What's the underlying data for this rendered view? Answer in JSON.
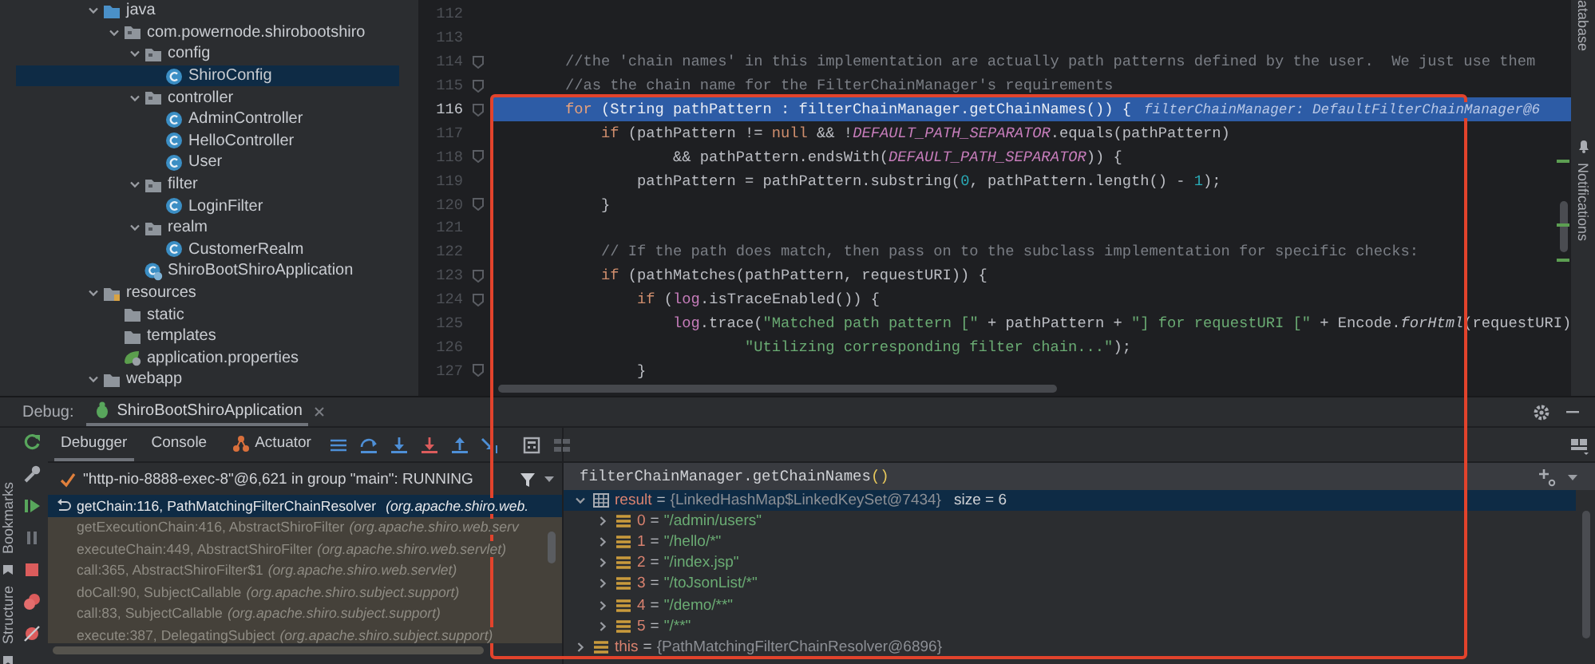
{
  "project_tree": [
    {
      "label": "java",
      "kind": "source-folder",
      "expanded": true,
      "selected": false,
      "children": [
        {
          "label": "com.powernode.shirobootshiro",
          "kind": "package",
          "expanded": true,
          "selected": false,
          "children": [
            {
              "label": "config",
              "kind": "package",
              "expanded": true,
              "selected": false,
              "children": [
                {
                  "label": "ShiroConfig",
                  "kind": "class",
                  "selected": true
                }
              ]
            },
            {
              "label": "controller",
              "kind": "package",
              "expanded": true,
              "selected": false,
              "children": [
                {
                  "label": "AdminController",
                  "kind": "class",
                  "selected": false
                },
                {
                  "label": "HelloController",
                  "kind": "class",
                  "selected": false
                },
                {
                  "label": "User",
                  "kind": "class",
                  "selected": false
                }
              ]
            },
            {
              "label": "filter",
              "kind": "package",
              "expanded": true,
              "selected": false,
              "children": [
                {
                  "label": "LoginFilter",
                  "kind": "class",
                  "selected": false
                }
              ]
            },
            {
              "label": "realm",
              "kind": "package",
              "expanded": true,
              "selected": false,
              "children": [
                {
                  "label": "CustomerRealm",
                  "kind": "class",
                  "selected": false
                }
              ]
            },
            {
              "label": "ShiroBootShiroApplication",
              "kind": "app-class",
              "selected": false
            }
          ]
        }
      ]
    },
    {
      "label": "resources",
      "kind": "resource-folder",
      "expanded": true,
      "selected": false,
      "children": [
        {
          "label": "static",
          "kind": "folder",
          "selected": false
        },
        {
          "label": "templates",
          "kind": "folder",
          "selected": false
        },
        {
          "label": "application.properties",
          "kind": "properties",
          "selected": false
        }
      ]
    },
    {
      "label": "webapp",
      "kind": "folder",
      "expanded": true,
      "selected": false
    }
  ],
  "editor": {
    "lines": [
      {
        "number": "112",
        "current": false,
        "fold": false
      },
      {
        "number": "113",
        "current": false,
        "fold": false
      },
      {
        "number": "114",
        "current": false,
        "fold": true,
        "tokens": [
          {
            "kind": "comment",
            "text": "        //the 'chain names' in this implementation are actually path patterns defined by the user.  We just use them"
          }
        ]
      },
      {
        "number": "115",
        "current": false,
        "fold": true,
        "tokens": [
          {
            "kind": "comment",
            "text": "        //as the chain name for the FilterChainManager's requirements"
          }
        ]
      },
      {
        "number": "116",
        "current": true,
        "fold": true,
        "tokens": [
          {
            "kind": "keyword",
            "text": "        for"
          },
          {
            "kind": "plain",
            "text": " (String pathPattern : filterChainManager.getChainNames()) {"
          }
        ],
        "hint": "filterChainManager: DefaultFilterChainManager@6"
      },
      {
        "number": "117",
        "current": false,
        "fold": false,
        "tokens": [
          {
            "kind": "keyword",
            "text": "            if"
          },
          {
            "kind": "plain",
            "text": " (pathPattern != "
          },
          {
            "kind": "keyword",
            "text": "null"
          },
          {
            "kind": "plain",
            "text": " && !"
          },
          {
            "kind": "constant",
            "text": "DEFAULT_PATH_SEPARATOR"
          },
          {
            "kind": "plain",
            "text": ".equals(pathPattern)"
          }
        ]
      },
      {
        "number": "118",
        "current": false,
        "fold": true,
        "tokens": [
          {
            "kind": "plain",
            "text": "                    && pathPattern.endsWith("
          },
          {
            "kind": "constant",
            "text": "DEFAULT_PATH_SEPARATOR"
          },
          {
            "kind": "plain",
            "text": ")) {"
          }
        ]
      },
      {
        "number": "119",
        "current": false,
        "fold": false,
        "tokens": [
          {
            "kind": "plain",
            "text": "                pathPattern = pathPattern.substring("
          },
          {
            "kind": "number",
            "text": "0"
          },
          {
            "kind": "plain",
            "text": ", pathPattern.length() - "
          },
          {
            "kind": "number",
            "text": "1"
          },
          {
            "kind": "plain",
            "text": ");"
          }
        ]
      },
      {
        "number": "120",
        "current": false,
        "fold": true,
        "tokens": [
          {
            "kind": "plain",
            "text": "            }"
          }
        ]
      },
      {
        "number": "121",
        "current": false,
        "fold": false
      },
      {
        "number": "122",
        "current": false,
        "fold": false,
        "tokens": [
          {
            "kind": "comment",
            "text": "            // If the path does match, then pass on to the subclass implementation for specific checks:"
          }
        ]
      },
      {
        "number": "123",
        "current": false,
        "fold": true,
        "tokens": [
          {
            "kind": "keyword",
            "text": "            if"
          },
          {
            "kind": "plain",
            "text": " (pathMatches(pathPattern, requestURI)) {"
          }
        ]
      },
      {
        "number": "124",
        "current": false,
        "fold": true,
        "tokens": [
          {
            "kind": "keyword",
            "text": "                if"
          },
          {
            "kind": "plain",
            "text": " ("
          },
          {
            "kind": "field",
            "text": "log"
          },
          {
            "kind": "plain",
            "text": ".isTraceEnabled()) {"
          }
        ]
      },
      {
        "number": "125",
        "current": false,
        "fold": false,
        "tokens": [
          {
            "kind": "field",
            "text": "                    log"
          },
          {
            "kind": "plain",
            "text": ".trace("
          },
          {
            "kind": "string",
            "text": "\"Matched path pattern [\""
          },
          {
            "kind": "plain",
            "text": " + pathPattern + "
          },
          {
            "kind": "string",
            "text": "\"] for requestURI [\""
          },
          {
            "kind": "plain",
            "text": " + Encode."
          },
          {
            "kind": "method",
            "text": "forHtml"
          },
          {
            "kind": "plain",
            "text": "(requestURI)"
          }
        ]
      },
      {
        "number": "126",
        "current": false,
        "fold": false,
        "tokens": [
          {
            "kind": "string",
            "text": "                            \"Utilizing corresponding filter chain...\""
          },
          {
            "kind": "plain",
            "text": ");"
          }
        ]
      },
      {
        "number": "127",
        "current": false,
        "fold": true,
        "tokens": [
          {
            "kind": "plain",
            "text": "                }"
          }
        ]
      }
    ]
  },
  "right_strip": [
    "atabase",
    "Notifications"
  ],
  "left_strip": [
    "Bookmarks",
    "Structure"
  ],
  "debug": {
    "title": "Debug:",
    "session": {
      "label": "ShiroBootShiroApplication",
      "closable": true
    },
    "tabs": [
      {
        "label": "Debugger",
        "kind": "text",
        "selected": true
      },
      {
        "label": "Console",
        "kind": "text",
        "selected": false
      },
      {
        "label": "Actuator",
        "kind": "plugin",
        "selected": false
      }
    ],
    "thread": "\"http-nio-8888-exec-8\"@6,621 in group \"main\": RUNNING",
    "frames": [
      {
        "method": "getChain:116, PathMatchingFilterChainResolver",
        "package": "(org.apache.shiro.web.",
        "selected": true
      },
      {
        "method": "getExecutionChain:416, AbstractShiroFilter",
        "package": "(org.apache.shiro.web.serv",
        "selected": false
      },
      {
        "method": "executeChain:449, AbstractShiroFilter",
        "package": "(org.apache.shiro.web.servlet)",
        "selected": false
      },
      {
        "method": "call:365, AbstractShiroFilter$1",
        "package": "(org.apache.shiro.web.servlet)",
        "selected": false
      },
      {
        "method": "doCall:90, SubjectCallable",
        "package": "(org.apache.shiro.subject.support)",
        "selected": false
      },
      {
        "method": "call:83, SubjectCallable",
        "package": "(org.apache.shiro.subject.support)",
        "selected": false
      },
      {
        "method": "execute:387, DelegatingSubject",
        "package": "(org.apache.shiro.subject.support)",
        "selected": false
      }
    ],
    "variables": {
      "call": "filterChainManager.getChainNames",
      "parens": "()",
      "items": [
        {
          "name": "result",
          "operator": "=",
          "value": "{LinkedHashMap$LinkedKeySet@7434}",
          "size": "size = 6",
          "kind": "collection",
          "expanded": true,
          "selected": true,
          "children": [
            {
              "name": "0",
              "operator": "=",
              "value": "\"/admin/users\"",
              "kind": "element",
              "expanded": false,
              "selected": false
            },
            {
              "name": "1",
              "operator": "=",
              "value": "\"/hello/*\"",
              "kind": "element",
              "expanded": false,
              "selected": false
            },
            {
              "name": "2",
              "operator": "=",
              "value": "\"/index.jsp\"",
              "kind": "element",
              "expanded": false,
              "selected": false
            },
            {
              "name": "3",
              "operator": "=",
              "value": "\"/toJsonList/*\"",
              "kind": "element",
              "expanded": false,
              "selected": false
            },
            {
              "name": "4",
              "operator": "=",
              "value": "\"/demo/**\"",
              "kind": "element",
              "expanded": false,
              "selected": false
            },
            {
              "name": "5",
              "operator": "=",
              "value": "\"/**\"",
              "kind": "element",
              "expanded": false,
              "selected": false
            }
          ]
        },
        {
          "name": "this",
          "operator": "=",
          "value": "{PathMatchingFilterChainResolver@6896}",
          "kind": "object",
          "expanded": false,
          "selected": false
        }
      ]
    }
  }
}
